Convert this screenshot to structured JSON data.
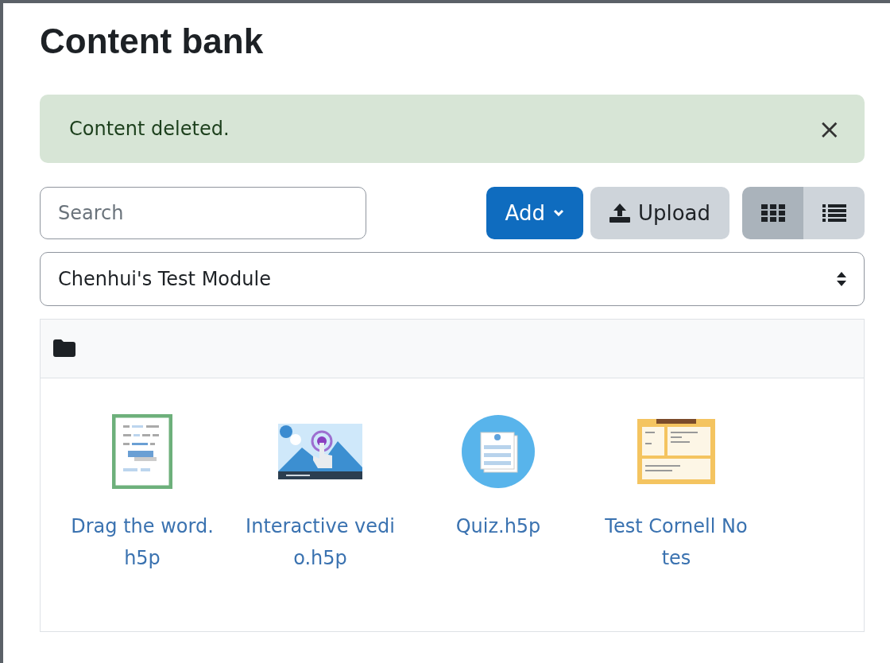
{
  "page": {
    "title": "Content bank"
  },
  "alert": {
    "message": "Content deleted.",
    "close": "×"
  },
  "search": {
    "placeholder": "Search"
  },
  "buttons": {
    "add": "Add",
    "upload": "Upload"
  },
  "view_toggle": [
    {
      "kind": "grid",
      "selected": true
    },
    {
      "kind": "list",
      "selected": false
    }
  ],
  "context_select": {
    "value": "Chenhui's Test Module"
  },
  "items": [
    {
      "kind": "drag-words",
      "name_lines": [
        "Drag the word.",
        "h5p"
      ]
    },
    {
      "kind": "video",
      "name_lines": [
        "Interactive vedi",
        "o.h5p"
      ]
    },
    {
      "kind": "quiz",
      "name_lines": [
        "Quiz.h5p"
      ]
    },
    {
      "kind": "notes",
      "name_lines": [
        "Test Cornell No",
        "tes"
      ]
    }
  ]
}
